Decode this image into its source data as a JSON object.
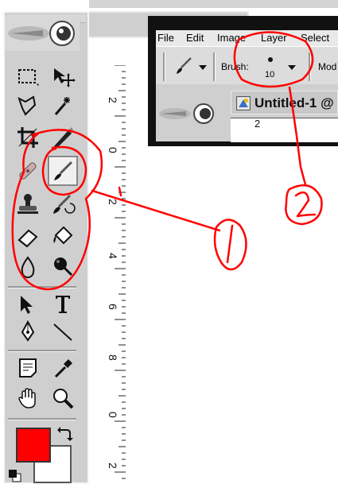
{
  "canvas": {
    "title": "U",
    "ruler_top_label": "2",
    "ruler_labels": [
      "2",
      "0",
      "2",
      "4",
      "6",
      "8",
      "0",
      "2"
    ]
  },
  "inset": {
    "menu": [
      "File",
      "Edit",
      "Image",
      "Layer",
      "Select"
    ],
    "brush_label": "Brush:",
    "brush_size": "10",
    "mode_label": "Mod",
    "doc_title": "Untitled-1 @",
    "ruler_label": "2"
  },
  "toolbox": {
    "tools": [
      {
        "name": "rectangular-marquee-tool-icon"
      },
      {
        "name": "move-tool-icon"
      },
      {
        "name": "lasso-tool-icon"
      },
      {
        "name": "magic-wand-tool-icon"
      },
      {
        "name": "crop-tool-icon"
      },
      {
        "name": "slice-tool-icon"
      },
      {
        "name": "healing-brush-tool-icon"
      },
      {
        "name": "brush-tool-icon"
      },
      {
        "name": "clone-stamp-tool-icon"
      },
      {
        "name": "history-brush-tool-icon"
      },
      {
        "name": "eraser-tool-icon"
      },
      {
        "name": "paint-bucket-tool-icon"
      },
      {
        "name": "blur-tool-icon"
      },
      {
        "name": "dodge-tool-icon"
      },
      {
        "name": "path-selection-tool-icon"
      },
      {
        "name": "type-tool-icon"
      },
      {
        "name": "pen-tool-icon"
      },
      {
        "name": "line-tool-icon"
      },
      {
        "name": "notes-tool-icon"
      },
      {
        "name": "eyedropper-tool-icon"
      },
      {
        "name": "hand-tool-icon"
      },
      {
        "name": "zoom-tool-icon"
      }
    ],
    "selected_tool": "brush-tool-icon",
    "foreground_color": "#ff0000",
    "background_color": "#ffffff"
  },
  "annotations": {
    "color": "#ff0000",
    "label_1": "1",
    "label_2": "2"
  }
}
